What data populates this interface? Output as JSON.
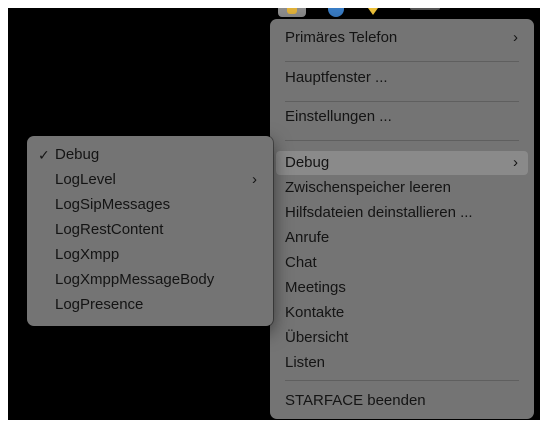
{
  "main_menu": {
    "items": [
      {
        "label": "Primäres Telefon",
        "chevron": "›"
      },
      {
        "label": "Hauptfenster ..."
      },
      {
        "label": "Einstellungen ..."
      },
      {
        "label": "Debug",
        "chevron": "›",
        "highlighted": true
      },
      {
        "label": "Zwischenspeicher leeren"
      },
      {
        "label": "Hilfsdateien deinstallieren ..."
      },
      {
        "label": "Anrufe"
      },
      {
        "label": "Chat"
      },
      {
        "label": "Meetings"
      },
      {
        "label": "Kontakte"
      },
      {
        "label": "Übersicht"
      },
      {
        "label": "Listen"
      },
      {
        "label": "STARFACE beenden"
      }
    ]
  },
  "debug_submenu": {
    "items": [
      {
        "label": "Debug",
        "checked": true,
        "check": "✓"
      },
      {
        "label": "LogLevel",
        "chevron": "›"
      },
      {
        "label": "LogSipMessages"
      },
      {
        "label": "LogRestContent"
      },
      {
        "label": "LogXmpp"
      },
      {
        "label": "LogXmppMessageBody"
      },
      {
        "label": "LogPresence"
      }
    ]
  },
  "menubar_icons": [
    "app-icon",
    "blue-status-icon",
    "warning-icon",
    "menubar-extra-icon"
  ],
  "colors": {
    "menu_bg": "#747474",
    "highlight": "#8a8a8a",
    "text": "#141414",
    "background": "#000000"
  }
}
